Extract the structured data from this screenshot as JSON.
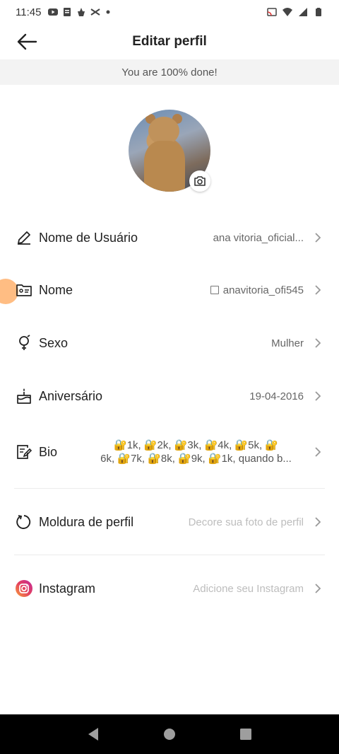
{
  "status_bar": {
    "time": "11:45"
  },
  "header": {
    "title": "Editar perfil"
  },
  "banner": {
    "text": "You are 100% done!"
  },
  "rows": [
    {
      "label": "Nome de Usuário",
      "value": "ana vitoria_oficial..."
    },
    {
      "label": "Nome",
      "value": "anavitoria_ofi545"
    },
    {
      "label": "Sexo",
      "value": "Mulher"
    },
    {
      "label": "Aniversário",
      "value": "19-04-2016"
    },
    {
      "label": "Bio",
      "value_line1": "🔐1k,  🔐2k,  🔐3k,  🔐4k,  🔐5k,  🔐",
      "value_line2": "6k,  🔐7k, 🔐8k,  🔐9k, 🔐1k,  quando b..."
    },
    {
      "label": "Moldura de perfil",
      "placeholder": "Decore sua foto de perfil"
    },
    {
      "label": "Instagram",
      "placeholder": "Adicione seu Instagram"
    }
  ],
  "colors": {
    "accent_touch": "#ffa75a",
    "instagram_gradient_start": "#f9a13a",
    "instagram_gradient_end": "#c2289b"
  }
}
